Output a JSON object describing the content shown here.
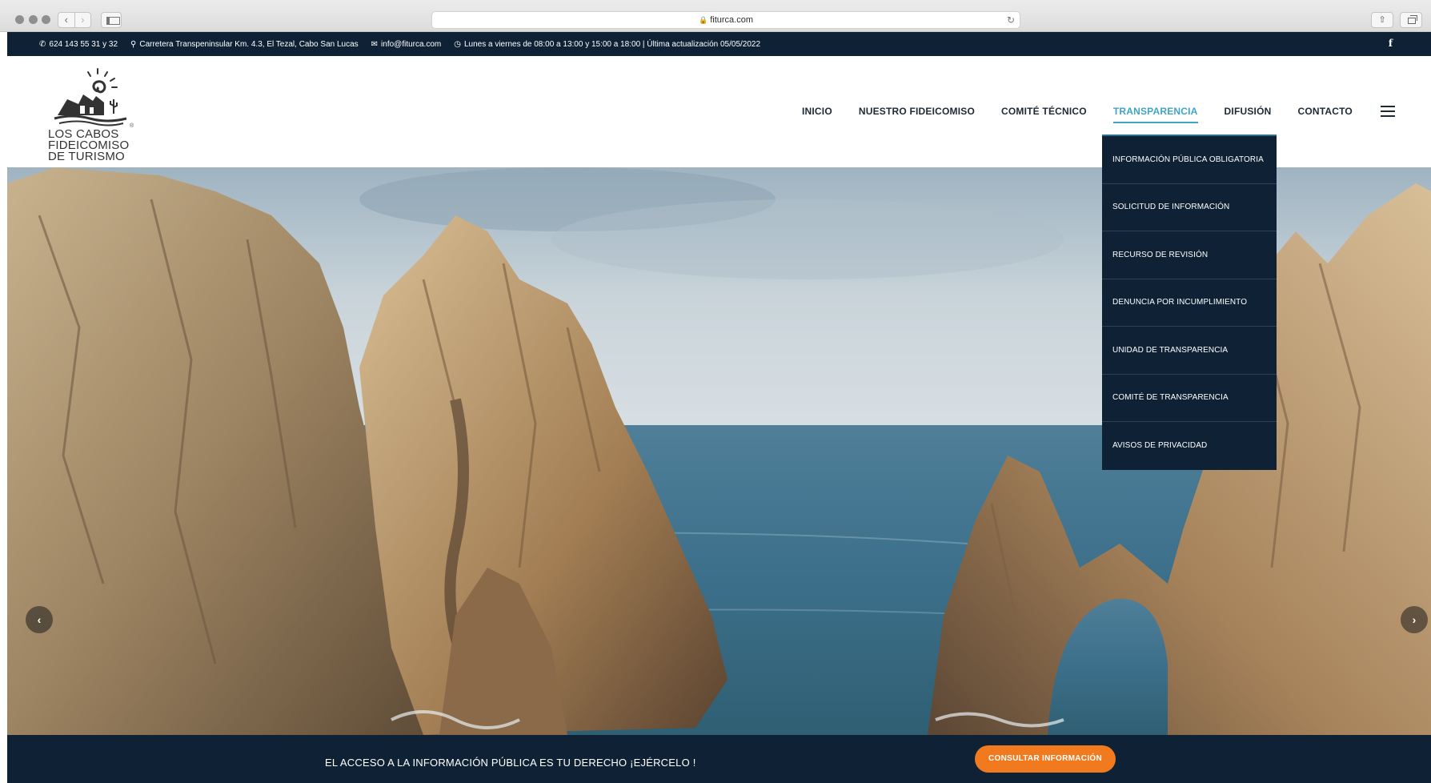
{
  "browser": {
    "url": "fiturca.com"
  },
  "topbar": {
    "phone": "624 143 55 31 y 32",
    "address": "Carretera Transpeninsular Km. 4.3, El Tezal, Cabo San Lucas",
    "email": "info@fiturca.com",
    "hours": "Lunes a viernes de 08:00 a 13:00 y 15:00 a 18:00 | Última actualización 05/05/2022",
    "social": "f"
  },
  "logo": {
    "line1": "LOS CABOS",
    "line2": "FIDEICOMISO",
    "line3": "DE TURISMO",
    "reg": "®"
  },
  "nav": {
    "items": [
      {
        "label": "INICIO"
      },
      {
        "label": "NUESTRO FIDEICOMISO"
      },
      {
        "label": "COMITÉ TÉCNICO"
      },
      {
        "label": "TRANSPARENCIA"
      },
      {
        "label": "DIFUSIÓN"
      },
      {
        "label": "CONTACTO"
      }
    ],
    "active": "TRANSPARENCIA"
  },
  "dropdown": {
    "items": [
      {
        "label": "INFORMACIÓN PÚBLICA OBLIGATORIA"
      },
      {
        "label": "SOLICITUD DE INFORMACIÓN"
      },
      {
        "label": "RECURSO DE REVISIÓN"
      },
      {
        "label": "DENUNCIA POR INCUMPLIMIENTO"
      },
      {
        "label": "UNIDAD DE TRANSPARENCIA"
      },
      {
        "label": "COMITÉ DE TRANSPARENCIA"
      },
      {
        "label": "AVISOS DE PRIVACIDAD"
      }
    ]
  },
  "hero": {
    "prev": "‹",
    "next": "›"
  },
  "banner": {
    "text": "EL ACCESO A LA INFORMACIÓN PÚBLICA ES TU DERECHO ¡EJÉRCELO !",
    "button": "CONSULTAR INFORMACIÓN"
  },
  "colors": {
    "navy": "#0f2235",
    "accent": "#3fa4c6",
    "cta": "#f07a1d"
  }
}
